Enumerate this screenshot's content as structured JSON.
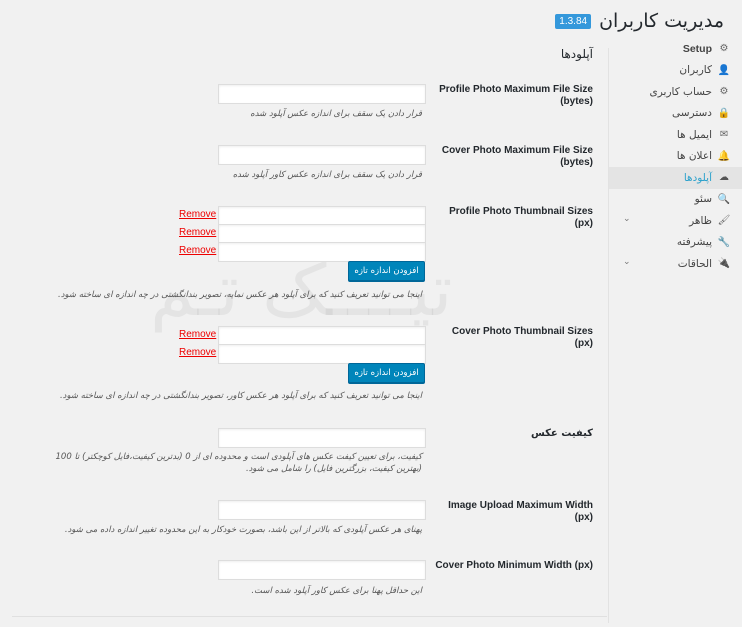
{
  "header": {
    "title": "مدیریت کاربران",
    "version": "1.3.84"
  },
  "sidebar": {
    "items": [
      {
        "label": "Setup",
        "icon": "gear-icon",
        "glyph": "⚙",
        "bold": true
      },
      {
        "label": "کاربران",
        "icon": "user-icon",
        "glyph": "👤"
      },
      {
        "label": "حساب کاربری",
        "icon": "gear-icon",
        "glyph": "⚙"
      },
      {
        "label": "دسترسی",
        "icon": "lock-icon",
        "glyph": "🔒"
      },
      {
        "label": "ایمیل ها",
        "icon": "envelope-icon",
        "glyph": "✉"
      },
      {
        "label": "اعلان ها",
        "icon": "bell-icon",
        "glyph": "🔔"
      },
      {
        "label": "آپلودها",
        "icon": "cloud-upload-icon",
        "glyph": "☁",
        "active": true
      },
      {
        "label": "سئو",
        "icon": "search-icon",
        "glyph": "🔍"
      },
      {
        "label": "ظاهر",
        "icon": "brush-icon",
        "glyph": "🖌",
        "chevron": "⌄"
      },
      {
        "label": "پیشرفته",
        "icon": "wrench-icon",
        "glyph": "🔧"
      },
      {
        "label": "الحاقات",
        "icon": "plug-icon",
        "glyph": "🔌",
        "chevron": "⌄"
      }
    ]
  },
  "main": {
    "section_title": "آپلودها",
    "fields": {
      "profile_max_size": {
        "label_line1": "Profile Photo Maximum File Size",
        "label_line2": "(bytes)",
        "value": "",
        "desc": "قرار دادن یک سقف برای اندازه عکس آپلود شده"
      },
      "cover_max_size": {
        "label_line1": "Cover Photo Maximum File Size",
        "label_line2": "(bytes)",
        "value": "",
        "desc": "قرار دادن یک سقف برای اندازه عکس کاور آپلود شده"
      },
      "profile_thumb_sizes": {
        "label": "Profile Photo Thumbnail Sizes (px)",
        "values": [
          "",
          "",
          ""
        ],
        "remove_label": "Remove",
        "add_label": "افزودن اندازه تازه",
        "desc": "اینجا می توانید تعریف کنید که برای آپلود هر عکس نمایه، تصویر بندانگشتی در چه اندازه ای ساخته شود."
      },
      "cover_thumb_sizes": {
        "label": "Cover Photo Thumbnail Sizes (px)",
        "values": [
          "",
          ""
        ],
        "remove_label": "Remove",
        "add_label": "افزودن اندازه تازه",
        "desc": "اینجا می توانید تعریف کنید که برای آپلود هر عکس کاور، تصویر بندانگشتی در چه اندازه ای ساخته شود."
      },
      "image_quality": {
        "label": "کیفیت عکس",
        "value": "",
        "desc_line1": "کیفیت، برای تعیین کیفت عکس های آپلودی است و محدوده ای از 0 (بدترین کیفیت،فایل کوچکتر) تا 100",
        "desc_line2": "(بهترین کیفیت، بزرگترین فایل) را شامل می شود."
      },
      "image_max_width": {
        "label": "Image Upload Maximum Width (px)",
        "value": "",
        "desc": "پهنای هر عکس آپلودی که بالاتر از این باشد، بصورت خودکار به این محدوده تغییر اندازه داده می شود."
      },
      "cover_min_width": {
        "label": "Cover Photo Minimum Width (px)",
        "value": "",
        "desc": "این حداقل پهنا برای عکس کاور آپلود شده است."
      }
    },
    "watermark": "تیــــک تـم"
  }
}
